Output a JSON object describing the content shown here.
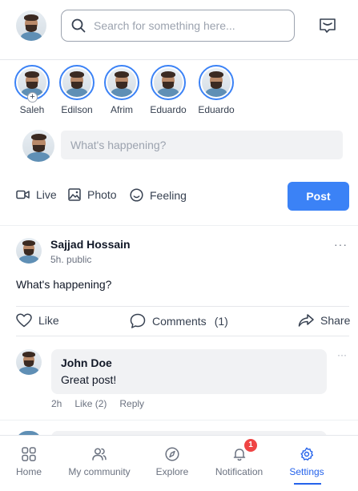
{
  "header": {
    "search_placeholder": "Search for something here..."
  },
  "stories": [
    {
      "name": "Saleh",
      "is_self": true
    },
    {
      "name": "Edilson"
    },
    {
      "name": "Afrim"
    },
    {
      "name": "Eduardo"
    },
    {
      "name": "Eduardo"
    }
  ],
  "composer": {
    "placeholder": "What's happening?",
    "actions": {
      "live": "Live",
      "photo": "Photo",
      "feeling": "Feeling"
    },
    "post_label": "Post"
  },
  "post": {
    "author": "Sajjad Hossain",
    "meta": "5h. public",
    "more": "···",
    "body": "What's happening?",
    "like_label": "Like",
    "comments_label": "Comments",
    "comments_count": "(1)",
    "share_label": "Share"
  },
  "comment": {
    "author": "John Doe",
    "text": "Great post!",
    "more": "···",
    "time": "2h",
    "like": "Like (2)",
    "reply": "Reply"
  },
  "nav": {
    "items": [
      {
        "label": "Home",
        "icon": "home-grid-icon"
      },
      {
        "label": "My community",
        "icon": "people-icon"
      },
      {
        "label": "Explore",
        "icon": "compass-icon"
      },
      {
        "label": "Notification",
        "icon": "bell-icon",
        "badge": "1"
      },
      {
        "label": "Settings",
        "icon": "gear-icon",
        "active": true
      }
    ]
  },
  "colors": {
    "accent": "#3b82f6",
    "active_nav": "#2563eb",
    "badge": "#ef4444"
  }
}
